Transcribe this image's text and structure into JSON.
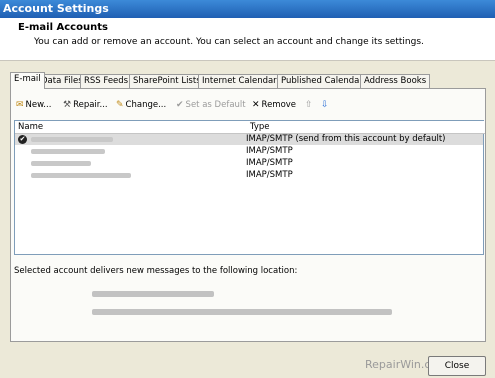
{
  "window": {
    "title": "Account Settings"
  },
  "header": {
    "title": "E-mail Accounts",
    "subtitle": "You can add or remove an account. You can select an account and change its settings."
  },
  "tabs": [
    {
      "label": "E-mail",
      "active": true
    },
    {
      "label": "Data Files"
    },
    {
      "label": "RSS Feeds"
    },
    {
      "label": "SharePoint Lists"
    },
    {
      "label": "Internet Calendars"
    },
    {
      "label": "Published Calendars"
    },
    {
      "label": "Address Books"
    }
  ],
  "toolbar": {
    "new": "New...",
    "repair": "Repair...",
    "change": "Change...",
    "set_default": "Set as Default",
    "remove": "Remove"
  },
  "list": {
    "columns": [
      "Name",
      "Type"
    ],
    "rows": [
      {
        "type": "IMAP/SMTP (send from this account by default)",
        "default": true
      },
      {
        "type": "IMAP/SMTP"
      },
      {
        "type": "IMAP/SMTP"
      },
      {
        "type": "IMAP/SMTP"
      }
    ]
  },
  "delivery": {
    "label": "Selected account delivers new messages to the following location:"
  },
  "watermark": "RepairWin.com",
  "buttons": {
    "close": "Close"
  },
  "colors": {
    "titlebar": "#1f5fb3",
    "dialog_bg": "#ece9d8",
    "selection": "#dcdcdc"
  }
}
